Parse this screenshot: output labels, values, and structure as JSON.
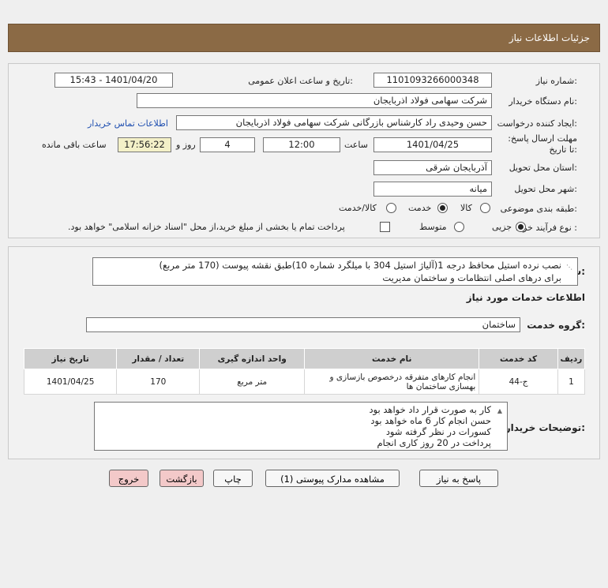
{
  "header": {
    "title": "جزئیات اطلاعات نیاز"
  },
  "form": {
    "need_number_label": "شماره نیاز:",
    "need_number": "1101093266000348",
    "announce_label": "تاریخ و ساعت اعلان عمومی:",
    "announce_value": "1401/04/20 - 15:43",
    "buyer_org_label": "نام دستگاه خریدار:",
    "buyer_org": "شرکت سهامی فولاد اذربایجان",
    "creator_label": "ایجاد کننده درخواست:",
    "creator": "حسن وحیدی راد کارشناس بازرگانی شرکت سهامی فولاد اذربایجان",
    "contact_link": "اطلاعات تماس خریدار",
    "deadline_label": "مهلت ارسال پاسخ: تا تاریخ:",
    "deadline_date": "1401/04/25",
    "time_label": "ساعت",
    "deadline_time": "12:00",
    "days_value": "4",
    "days_label": "روز و",
    "remaining_time": "17:56:22",
    "remaining_label": "ساعت باقی مانده",
    "province_label": "استان محل تحویل:",
    "province": "آذربایجان شرقی",
    "city_label": "شهر محل تحویل:",
    "city": "میانه",
    "category_label": "طبقه بندی موضوعی:",
    "category_options": [
      "کالا",
      "خدمت",
      "کالا/خدمت"
    ],
    "category_selected": "خدمت",
    "process_label": "نوع فرآیند خرید :",
    "process_options": [
      "جزیی",
      "متوسط"
    ],
    "process_selected": "جزیی",
    "payment_text": "پرداخت تمام یا بخشی از مبلغ خرید،از محل \"اسناد خزانه اسلامی\" خواهد بود."
  },
  "details": {
    "summary_label": "شرح کلی نیاز:",
    "summary_line1": "نصب نرده استیل محافظ درجه 1(آلیاژ استیل 304 با میلگرد شماره 10)طبق نقشه پیوست (170 متر مربع)",
    "summary_line2": "برای درهای اصلی انتظامات و ساختمان مدیریت",
    "services_heading": "اطلاعات خدمات مورد نیاز",
    "service_group_label": "گروه خدمت:",
    "service_group": "ساختمان",
    "table": {
      "headers": [
        "ردیف",
        "کد خدمت",
        "نام خدمت",
        "واحد اندازه گیری",
        "تعداد / مقدار",
        "تاریخ نیاز"
      ],
      "rows": [
        [
          "1",
          "ج-44",
          "انجام کارهای متفرقه درخصوص بازسازی و بهسازی ساختمان ها",
          "متر مربع",
          "170",
          "1401/04/25"
        ]
      ]
    },
    "buyer_notes_label": "توضیحات خریدار:",
    "buyer_notes": [
      "کار به صورت قرار داد خواهد بود",
      "حسن انجام کار 6 ماه خواهد بود",
      "کسورات در نظر گرفته شود",
      "پرداخت در 20 روز کاری انجام"
    ]
  },
  "buttons": {
    "reply": "پاسخ به نیاز",
    "attachments": "مشاهده مدارک پیوستی (1)",
    "print": "چاپ",
    "back": "بازگشت",
    "exit": "خروج"
  }
}
